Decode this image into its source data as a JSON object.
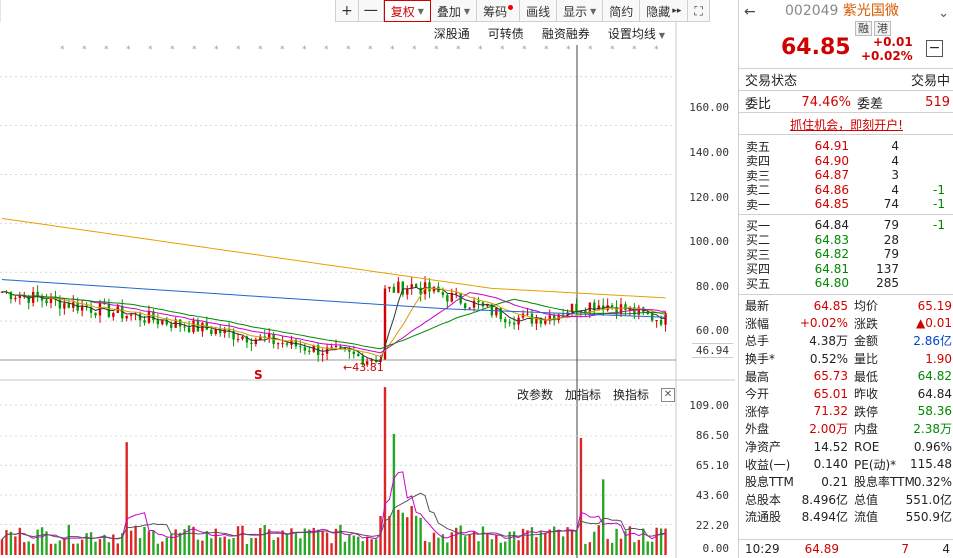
{
  "toolbar": {
    "plus": "+",
    "minus": "一",
    "fuquan": "复权",
    "diejia": "叠加",
    "chouma": "筹码",
    "huaxian": "画线",
    "xianshi": "显示",
    "jianyue": "简约",
    "yincang": "隐藏",
    "more": "▸▸",
    "fullscreen": "⛶"
  },
  "subtoolbar": {
    "shengutong": "深股通",
    "kezhuanzhai": "可转债",
    "rongzirongquan": "融资融券",
    "shezhijunxian": "设置均线"
  },
  "indicator_toolbar": {
    "gaicanshu": "改参数",
    "jiazhibiao": "加指标",
    "huanzhibiao": "换指标",
    "close": "✕"
  },
  "chart_data": [
    {
      "type": "candlestick",
      "yaxis_ticks": [
        "160.00",
        "140.00",
        "120.00",
        "100.00",
        "80.00",
        "60.00"
      ],
      "cursor_value": "46.94",
      "low_marker": "43.81",
      "event_marker": "S",
      "ylim": [
        40,
        175
      ]
    },
    {
      "type": "bar",
      "yaxis_ticks": [
        "109.00",
        "86.50",
        "65.10",
        "43.60",
        "22.20",
        "0.00"
      ],
      "ylim": [
        0,
        109
      ]
    }
  ],
  "header": {
    "code": "002049",
    "name": "紫光国微",
    "tag1": "融",
    "tag2": "港",
    "price": "64.85",
    "change": "+0.01",
    "change_pct": "+0.02%"
  },
  "status": {
    "label": "交易状态",
    "value": "交易中",
    "weibi_label": "委比",
    "weibi": "74.46%",
    "weicha_label": "委差",
    "weicha": "519"
  },
  "ad": "抓住机会，即刻开户!",
  "sell": [
    {
      "label": "卖五",
      "price": "64.91",
      "vol": "4",
      "chg": ""
    },
    {
      "label": "卖四",
      "price": "64.90",
      "vol": "4",
      "chg": ""
    },
    {
      "label": "卖三",
      "price": "64.87",
      "vol": "3",
      "chg": ""
    },
    {
      "label": "卖二",
      "price": "64.86",
      "vol": "4",
      "chg": "-1"
    },
    {
      "label": "卖一",
      "price": "64.85",
      "vol": "74",
      "chg": "-1"
    }
  ],
  "buy": [
    {
      "label": "买一",
      "price": "64.84",
      "vol": "79",
      "chg": "-1"
    },
    {
      "label": "买二",
      "price": "64.83",
      "vol": "28",
      "chg": ""
    },
    {
      "label": "买三",
      "price": "64.82",
      "vol": "79",
      "chg": ""
    },
    {
      "label": "买四",
      "price": "64.81",
      "vol": "137",
      "chg": ""
    },
    {
      "label": "买五",
      "price": "64.80",
      "vol": "285",
      "chg": ""
    }
  ],
  "stats": [
    {
      "k1": "最新",
      "v1": "64.85",
      "c1": "red",
      "k2": "均价",
      "v2": "65.19",
      "c2": "red"
    },
    {
      "k1": "涨幅",
      "v1": "+0.02%",
      "c1": "red",
      "k2": "涨跌",
      "v2": "▲0.01",
      "c2": "red"
    },
    {
      "k1": "总手",
      "v1": "4.38万",
      "c1": "",
      "k2": "金额",
      "v2": "2.86亿",
      "c2": "blue"
    },
    {
      "k1": "换手*",
      "v1": "0.52%",
      "c1": "",
      "k2": "量比",
      "v2": "1.90",
      "c2": "red"
    },
    {
      "k1": "最高",
      "v1": "65.73",
      "c1": "red",
      "k2": "最低",
      "v2": "64.82",
      "c2": "green"
    },
    {
      "k1": "今开",
      "v1": "65.01",
      "c1": "red",
      "k2": "昨收",
      "v2": "64.84",
      "c2": ""
    },
    {
      "k1": "涨停",
      "v1": "71.32",
      "c1": "red",
      "k2": "跌停",
      "v2": "58.36",
      "c2": "green"
    },
    {
      "k1": "外盘",
      "v1": "2.00万",
      "c1": "red",
      "k2": "内盘",
      "v2": "2.38万",
      "c2": "green"
    },
    {
      "k1": "净资产",
      "v1": "14.52",
      "c1": "",
      "k2": "ROE",
      "v2": "0.96%",
      "c2": ""
    },
    {
      "k1": "收益(一)",
      "v1": "0.140",
      "c1": "",
      "k2": "PE(动)*",
      "v2": "115.48",
      "c2": ""
    },
    {
      "k1": "股息TTM",
      "v1": "0.21",
      "c1": "",
      "k2": "股息率TTM",
      "v2": "0.32%",
      "c2": ""
    },
    {
      "k1": "总股本",
      "v1": "8.496亿",
      "c1": "",
      "k2": "总值",
      "v2": "551.0亿",
      "c2": ""
    },
    {
      "k1": "流通股",
      "v1": "8.494亿",
      "c1": "",
      "k2": "流值",
      "v2": "550.9亿",
      "c2": ""
    }
  ],
  "tick": {
    "time": "10:29",
    "price": "64.89",
    "vol": "7",
    "num": "4"
  }
}
